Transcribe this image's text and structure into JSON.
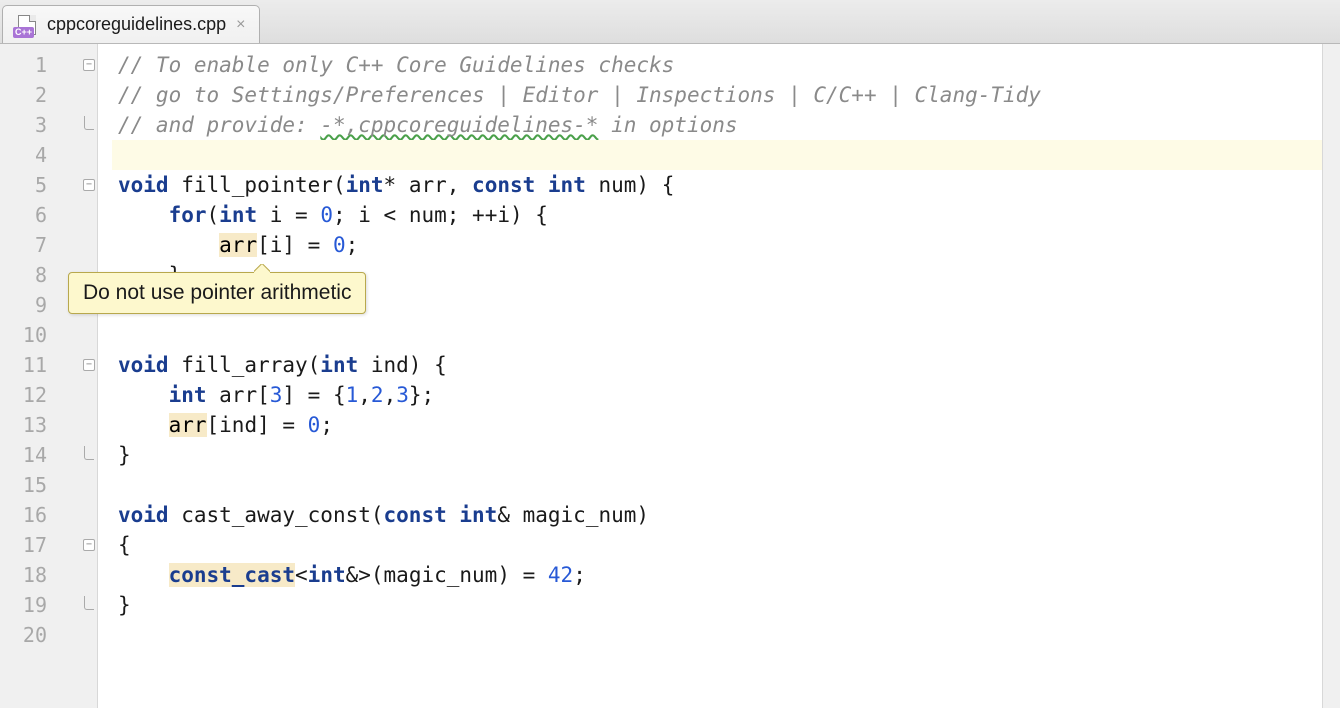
{
  "tab": {
    "filename": "cppcoreguidelines.cpp",
    "icon_badge": "C++"
  },
  "tooltip": {
    "text": "Do not use pointer arithmetic"
  },
  "lines": {
    "l1": "1",
    "l2": "2",
    "l3": "3",
    "l4": "4",
    "l5": "5",
    "l6": "6",
    "l7": "7",
    "l8": "8",
    "l9": "9",
    "l10": "10",
    "l11": "11",
    "l12": "12",
    "l13": "13",
    "l14": "14",
    "l15": "15",
    "l16": "16",
    "l17": "17",
    "l18": "18",
    "l19": "19",
    "l20": "20"
  },
  "code": {
    "c1": "// To enable only C++ Core Guidelines checks",
    "c2": "// go to Settings/Preferences | Editor | Inspections | C/C++ | Clang-Tidy",
    "c3_a": "// and provide: ",
    "c3_b": "-*,cppcoreguidelines-*",
    "c3_c": " in options",
    "c5_void": "void",
    "c5_fn": " fill_pointer(",
    "c5_int": "int",
    "c5_rest": "* arr, ",
    "c5_const": "const",
    "c5_int2": " int",
    "c5_num": " num) {",
    "c6_for": "for",
    "c6_a": "(",
    "c6_int": "int",
    "c6_b": " i = ",
    "c6_zero": "0",
    "c6_c": "; i < num; ++i) {",
    "c7_arr": "arr",
    "c7_a": "[i] = ",
    "c7_zero": "0",
    "c7_b": ";",
    "c8": "    }",
    "c11_void": "void",
    "c11_a": " fill_array(",
    "c11_int": "int",
    "c11_b": " ind) {",
    "c12_int": "int",
    "c12_a": " arr[",
    "c12_3": "3",
    "c12_b": "] = {",
    "c12_1": "1",
    "c12_c": ",",
    "c12_2": "2",
    "c12_d": ",",
    "c12_3b": "3",
    "c12_e": "};",
    "c13_arr": "arr",
    "c13_a": "[ind] = ",
    "c13_zero": "0",
    "c13_b": ";",
    "c14": "}",
    "c16_void": "void",
    "c16_a": " cast_away_const(",
    "c16_const": "const",
    "c16_int": " int",
    "c16_b": "& magic_num)",
    "c17": "{",
    "c18_cast": "const_cast",
    "c18_a": "<",
    "c18_int": "int",
    "c18_b": "&>(magic_num) = ",
    "c18_42": "42",
    "c18_c": ";",
    "c19": "}"
  }
}
